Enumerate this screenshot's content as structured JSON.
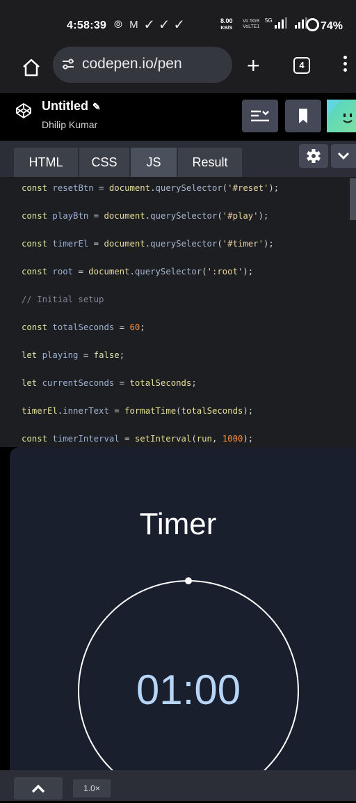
{
  "status_bar": {
    "time": "4:58:39",
    "left_icons": "⦾ M ✓ ✓ ✓",
    "net_speed_value": "8.00",
    "net_speed_unit": "KB/S",
    "volte_top": "Vo 5GB",
    "volte_bottom": "VoLTE1",
    "signal_5g": "5G",
    "battery": "74%"
  },
  "browser": {
    "url": "codepen.io/pen",
    "tab_count": "4",
    "icons": [
      "home-icon",
      "tune-icon",
      "plus-icon",
      "tabs-icon",
      "kebab-menu-icon"
    ]
  },
  "codepen": {
    "title": "Untitled",
    "author": "Dhilip Kumar",
    "icons": [
      "codepen-logo-icon",
      "pencil-icon",
      "layout-icon",
      "bookmark-icon",
      "settings-icon",
      "chevron-down-icon"
    ]
  },
  "editor_tabs": [
    {
      "label": "HTML",
      "active": false
    },
    {
      "label": "CSS",
      "active": false
    },
    {
      "label": "JS",
      "active": true
    },
    {
      "label": "Result",
      "active": false
    }
  ],
  "code_lines": [
    [
      [
        "kw",
        "const "
      ],
      [
        "var",
        "resetBtn"
      ],
      [
        "op",
        " = "
      ],
      [
        "doc",
        "document"
      ],
      [
        "op",
        "."
      ],
      [
        "fn",
        "querySelector"
      ],
      [
        "op",
        "("
      ],
      [
        "str",
        "'#reset'"
      ],
      [
        "op",
        ");"
      ]
    ],
    [
      [
        "kw",
        "const "
      ],
      [
        "var",
        "playBtn"
      ],
      [
        "op",
        " = "
      ],
      [
        "doc",
        "document"
      ],
      [
        "op",
        "."
      ],
      [
        "fn",
        "querySelector"
      ],
      [
        "op",
        "("
      ],
      [
        "str",
        "'#play'"
      ],
      [
        "op",
        ");"
      ]
    ],
    [
      [
        "kw",
        "const "
      ],
      [
        "var",
        "timerEl"
      ],
      [
        "op",
        " = "
      ],
      [
        "doc",
        "document"
      ],
      [
        "op",
        "."
      ],
      [
        "fn",
        "querySelector"
      ],
      [
        "op",
        "("
      ],
      [
        "str",
        "'#timer'"
      ],
      [
        "op",
        ");"
      ]
    ],
    [
      [
        "kw",
        "const "
      ],
      [
        "var",
        "root"
      ],
      [
        "op",
        " = "
      ],
      [
        "doc",
        "document"
      ],
      [
        "op",
        "."
      ],
      [
        "fn",
        "querySelector"
      ],
      [
        "op",
        "("
      ],
      [
        "str",
        "':root'"
      ],
      [
        "op",
        ");"
      ]
    ],
    [
      [
        "cm",
        "// Initial setup"
      ]
    ],
    [
      [
        "kw",
        "const "
      ],
      [
        "var",
        "totalSeconds"
      ],
      [
        "op",
        " = "
      ],
      [
        "num",
        "60"
      ],
      [
        "op",
        ";"
      ]
    ],
    [
      [
        "kw",
        "let "
      ],
      [
        "var",
        "playing"
      ],
      [
        "op",
        " = "
      ],
      [
        "kw",
        "false"
      ],
      [
        "op",
        ";"
      ]
    ],
    [
      [
        "kw",
        "let "
      ],
      [
        "var",
        "currentSeconds"
      ],
      [
        "op",
        " = "
      ],
      [
        "doc",
        "totalSeconds"
      ],
      [
        "op",
        ";"
      ]
    ],
    [
      [
        "doc",
        "timerEl"
      ],
      [
        "op",
        "."
      ],
      [
        "fn",
        "innerText"
      ],
      [
        "op",
        " = "
      ],
      [
        "doc",
        "formatTime"
      ],
      [
        "op",
        "("
      ],
      [
        "doc",
        "totalSeconds"
      ],
      [
        "op",
        ");"
      ]
    ],
    [
      [
        "kw",
        "const "
      ],
      [
        "var",
        "timerInterval"
      ],
      [
        "op",
        " = "
      ],
      [
        "doc",
        "setInterval"
      ],
      [
        "op",
        "("
      ],
      [
        "doc",
        "run"
      ],
      [
        "op",
        ", "
      ],
      [
        "num",
        "1000"
      ],
      [
        "op",
        ");"
      ]
    ]
  ],
  "result": {
    "heading": "Timer",
    "time_display": "01:00",
    "progress": 1.0
  },
  "bottom_bar": {
    "zoom": "1.0×",
    "icons": [
      "chevron-up-icon"
    ]
  },
  "colors": {
    "result_bg": "#1a1f2e",
    "timer_text": "#b7d5f7",
    "code_bg": "#1d1e22"
  }
}
